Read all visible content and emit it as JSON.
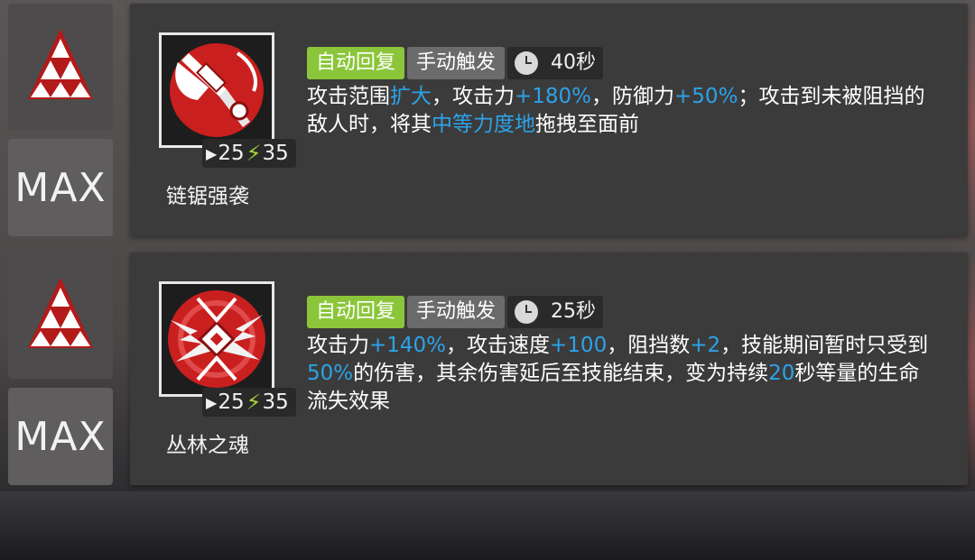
{
  "skills": [
    {
      "level": "MAX",
      "name": "链锯强袭",
      "initial_sp": "25",
      "sp_cost": "35",
      "recovery_tag": "自动回复",
      "trigger_tag": "手动触发",
      "duration": "40秒",
      "description": [
        {
          "t": "攻击范围",
          "h": false
        },
        {
          "t": "扩大",
          "h": true
        },
        {
          "t": "，攻击力",
          "h": false
        },
        {
          "t": "+180%",
          "h": true
        },
        {
          "t": "，防御力",
          "h": false
        },
        {
          "t": "+50%",
          "h": true
        },
        {
          "t": "；攻击到未被阻挡的敌人时，将其",
          "h": false
        },
        {
          "t": "中等力度地",
          "h": true
        },
        {
          "t": "拖拽至面前",
          "h": false
        }
      ]
    },
    {
      "level": "MAX",
      "name": "丛林之魂",
      "initial_sp": "25",
      "sp_cost": "35",
      "recovery_tag": "自动回复",
      "trigger_tag": "手动触发",
      "duration": "25秒",
      "description": [
        {
          "t": "攻击力",
          "h": false
        },
        {
          "t": "+140%",
          "h": true
        },
        {
          "t": "，攻击速度",
          "h": false
        },
        {
          "t": "+100",
          "h": true
        },
        {
          "t": "，阻挡数",
          "h": false
        },
        {
          "t": "+2",
          "h": true
        },
        {
          "t": "，技能期间暂时只受到",
          "h": false
        },
        {
          "t": "50%",
          "h": true
        },
        {
          "t": "的伤害，其余伤害延后至技能结束，变为持续",
          "h": false
        },
        {
          "t": "20",
          "h": true
        },
        {
          "t": "秒等量的生命流失效果",
          "h": false
        }
      ]
    }
  ],
  "colors": {
    "highlight": "#2ba3e8",
    "tag_green": "#8bc63a",
    "sp_bolt": "#a9d93a",
    "rank_red": "#b31a1a"
  },
  "icons": {
    "rank": "mastery-triangle-icon",
    "skill1": "chainsaw-axe-icon",
    "skill2": "jungle-beast-icon",
    "duration": "clock-icon",
    "initial_sp": "play-arrow-icon",
    "sp_cost": "lightning-bolt-icon"
  }
}
